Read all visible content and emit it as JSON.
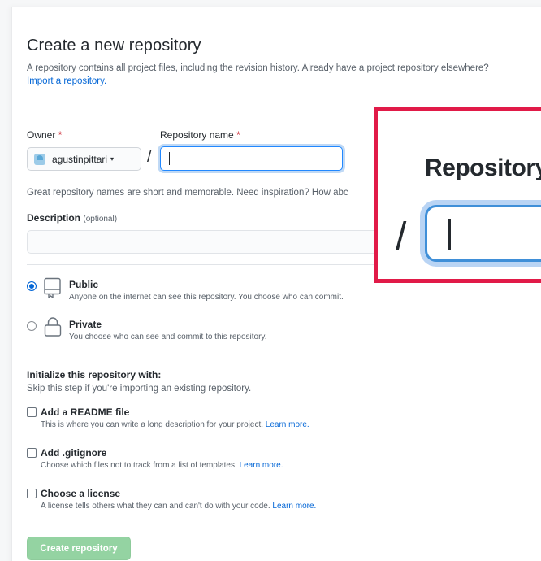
{
  "header": {
    "title": "Create a new repository",
    "subtitle": "A repository contains all project files, including the revision history. Already have a project repository elsewhere?",
    "import_link": "Import a repository."
  },
  "owner": {
    "label": "Owner",
    "required_mark": "*",
    "value": "agustinpittari",
    "caret": "▾"
  },
  "repo_name": {
    "label": "Repository name",
    "required_mark": "*",
    "value": "",
    "separator": "/"
  },
  "hint": "Great repository names are short and memorable. Need inspiration? How abc",
  "description": {
    "label": "Description",
    "optional": "(optional)",
    "value": ""
  },
  "visibility": [
    {
      "title": "Public",
      "desc": "Anyone on the internet can see this repository. You choose who can commit.",
      "selected": true
    },
    {
      "title": "Private",
      "desc": "You choose who can see and commit to this repository.",
      "selected": false
    }
  ],
  "init": {
    "heading": "Initialize this repository with:",
    "subheading": "Skip this step if you're importing an existing repository.",
    "options": [
      {
        "title": "Add a README file",
        "desc": "This is where you can write a long description for your project.",
        "learn": "Learn more."
      },
      {
        "title": "Add .gitignore",
        "desc": "Choose which files not to track from a list of templates.",
        "learn": "Learn more."
      },
      {
        "title": "Choose a license",
        "desc": "A license tells others what they can and can't do with your code.",
        "learn": "Learn more."
      }
    ]
  },
  "create_button": "Create repository",
  "zoom": {
    "label": "Repository",
    "separator": "/"
  },
  "colors": {
    "accent": "#0366d6",
    "highlight_border": "#e11a48",
    "create_button": "#94d3a2"
  }
}
